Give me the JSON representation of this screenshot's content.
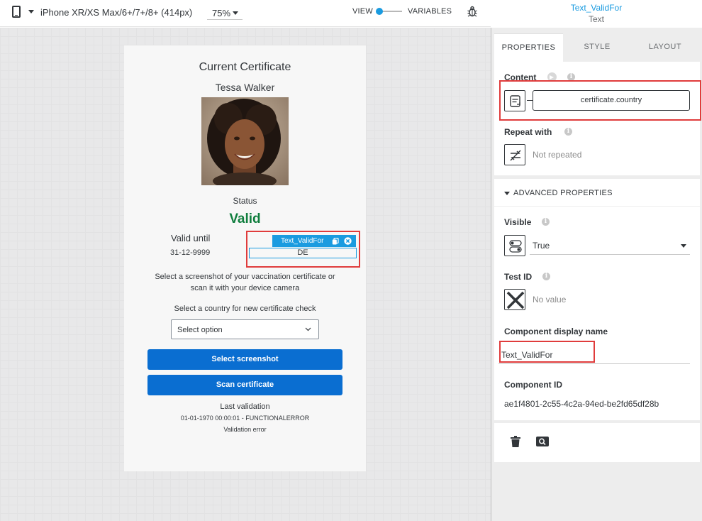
{
  "toolbar": {
    "device": "iPhone XR/XS Max/6+/7+/8+ (414px)",
    "zoom": "75%",
    "view_label": "VIEW",
    "variables_label": "VARIABLES"
  },
  "selection": {
    "name": "Text_ValidFor",
    "type": "Text"
  },
  "preview": {
    "title": "Current Certificate",
    "person_name": "Tessa Walker",
    "status_label": "Status",
    "status_value": "Valid",
    "valid_until_label": "Valid until",
    "valid_until_date": "31-12-9999",
    "selected_component_tag": "Text_ValidFor",
    "selected_component_value": "DE",
    "instructions_line1": "Select a screenshot of your vaccination certificate or",
    "instructions_line2": "scan it with your device camera",
    "country_label": "Select a country for new certificate check",
    "select_placeholder": "Select option",
    "btn_select_screenshot": "Select screenshot",
    "btn_scan_certificate": "Scan certificate",
    "last_validation_label": "Last validation",
    "last_validation_detail": "01-01-1970 00:00:01 - FUNCTIONALERROR",
    "validation_error": "Validation error"
  },
  "panel": {
    "tabs": [
      "PROPERTIES",
      "STYLE",
      "LAYOUT"
    ],
    "active_tab": "PROPERTIES",
    "content_label": "Content",
    "content_binding": "certificate.country",
    "repeat_label": "Repeat with",
    "repeat_value": "Not repeated",
    "advanced_header": "ADVANCED PROPERTIES",
    "visible_label": "Visible",
    "visible_value": "True",
    "test_id_label": "Test ID",
    "test_id_value": "No value",
    "display_name_label": "Component display name",
    "display_name_value": "Text_ValidFor",
    "component_id_label": "Component ID",
    "component_id_value": "ae1f4801-2c55-4c2a-94ed-be2fd65df28b"
  },
  "colors": {
    "accent": "#1a9be0",
    "button": "#0a6ed1",
    "valid_green": "#107e3e",
    "annotation_red": "#e03c3c"
  },
  "icons": [
    "phone-icon",
    "caret-down-icon",
    "toggle-icon",
    "bug-icon",
    "copy-icon",
    "close-icon",
    "chevron-down-icon",
    "info-icon",
    "arrow-right-icon",
    "binding-icon",
    "repeat-off-icon",
    "toggle-switch-icon",
    "cross-icon",
    "trash-icon",
    "search-icon"
  ]
}
